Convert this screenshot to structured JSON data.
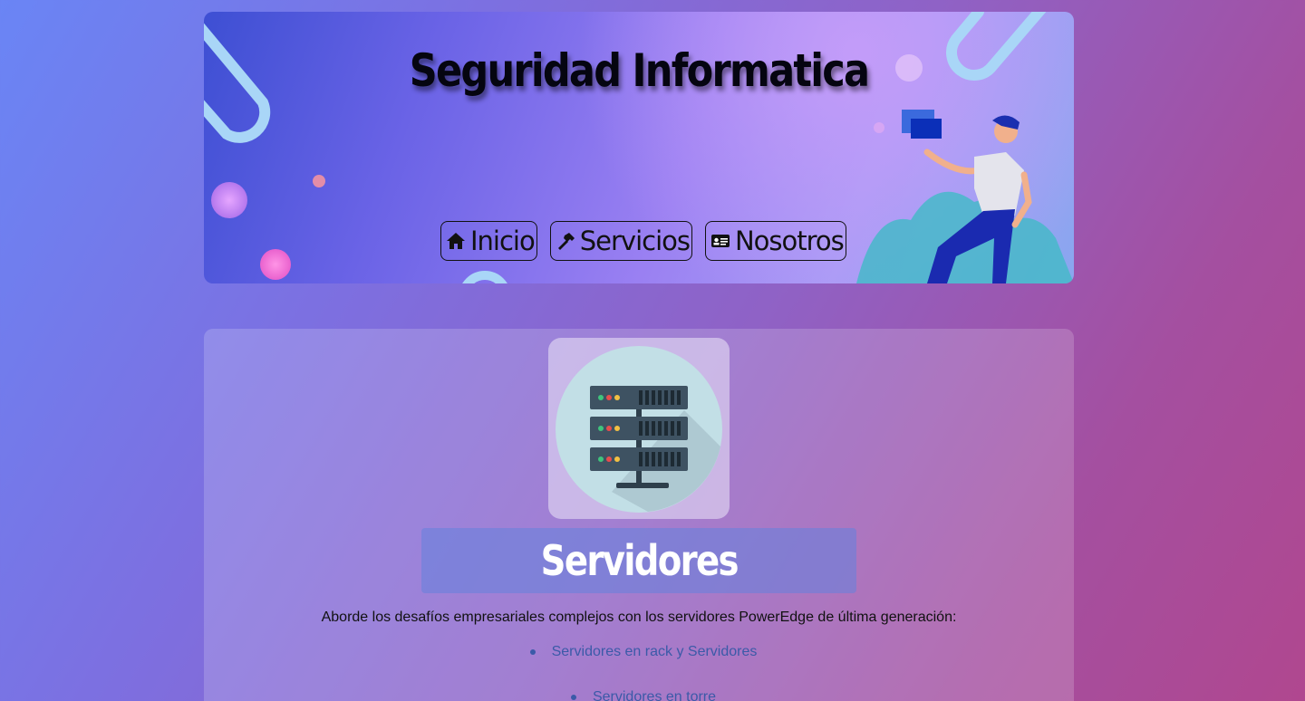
{
  "header": {
    "title": "Seguridad Informatica",
    "nav": [
      {
        "label": "Inicio",
        "icon": "home-icon"
      },
      {
        "label": "Servicios",
        "icon": "hammer-icon"
      },
      {
        "label": "Nosotros",
        "icon": "id-card-icon"
      }
    ]
  },
  "section": {
    "icon": "server-icon",
    "title": "Servidores",
    "intro": "Aborde los desafíos empresariales complejos con los servidores PowerEdge de última generación:",
    "items": [
      "Servidores en rack y Servidores",
      "Servidores en torre"
    ]
  },
  "colors": {
    "link": "#3b5aa8",
    "heading_bg": "#6482dc"
  }
}
